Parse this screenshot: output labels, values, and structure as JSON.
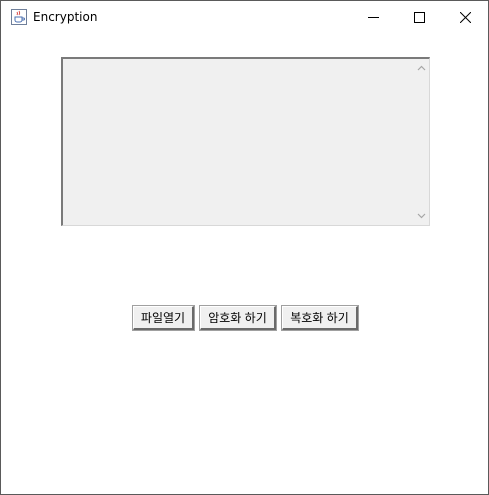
{
  "window": {
    "title": "Encryption",
    "icon": "java-cup-icon",
    "controls": {
      "minimize_icon": "minimize-icon",
      "maximize_icon": "maximize-icon",
      "close_icon": "close-icon"
    }
  },
  "text_area": {
    "value": ""
  },
  "buttons": {
    "open_file": "파일열기",
    "encrypt": "암호화 하기",
    "decrypt": "복호화 하기"
  }
}
